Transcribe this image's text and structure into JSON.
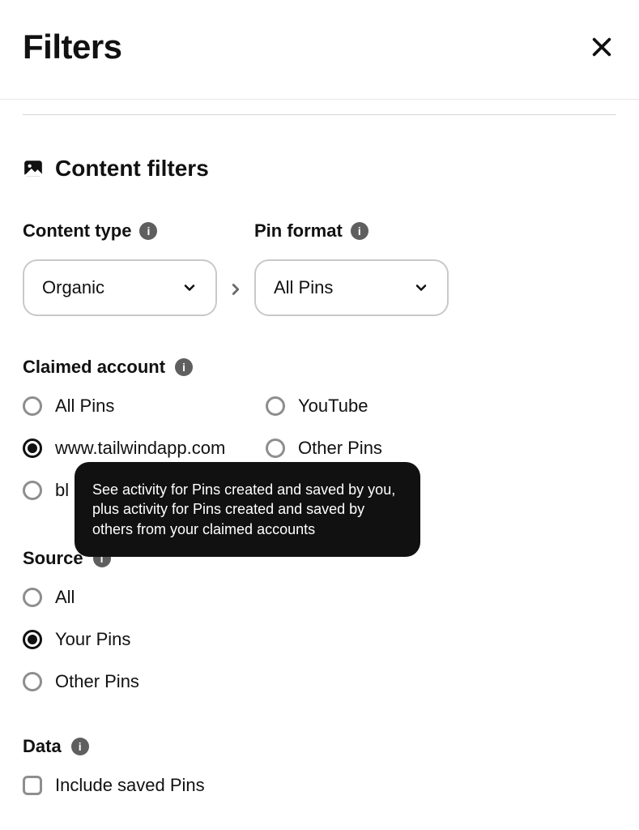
{
  "header": {
    "title": "Filters"
  },
  "section": {
    "title": "Content filters"
  },
  "content_type": {
    "label": "Content type",
    "selected": "Organic"
  },
  "pin_format": {
    "label": "Pin format",
    "selected": "All Pins"
  },
  "claimed_account": {
    "label": "Claimed account",
    "options": [
      {
        "label": "All Pins",
        "checked": false
      },
      {
        "label": "YouTube",
        "checked": false
      },
      {
        "label": "www.tailwindapp.com",
        "checked": true
      },
      {
        "label": "Other Pins",
        "checked": false
      },
      {
        "label": "bl",
        "checked": false
      }
    ]
  },
  "tooltip": {
    "text": "See activity for Pins created and saved by you, plus activity for Pins created and saved by others from your claimed accounts"
  },
  "source": {
    "label": "Source",
    "options": [
      {
        "label": "All",
        "checked": false
      },
      {
        "label": "Your Pins",
        "checked": true
      },
      {
        "label": "Other Pins",
        "checked": false
      }
    ]
  },
  "data_section": {
    "label": "Data",
    "checkbox": {
      "label": "Include saved Pins",
      "checked": false
    }
  }
}
